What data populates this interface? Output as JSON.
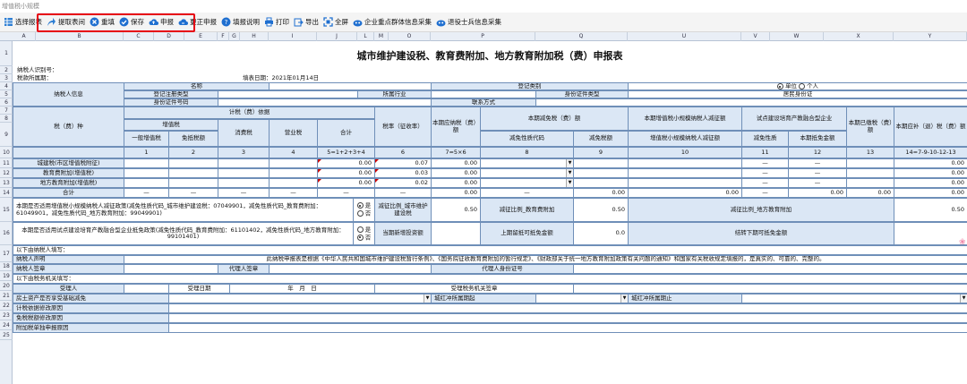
{
  "window": {
    "title": "增值税小规模"
  },
  "toolbar": {
    "items": [
      {
        "label": "选择报表",
        "icon": "table-icon"
      },
      {
        "label": "提取表间",
        "icon": "share-arrow-icon"
      },
      {
        "label": "重填",
        "icon": "clear-icon"
      },
      {
        "label": "保存",
        "icon": "check-circle-icon"
      },
      {
        "label": "申报",
        "icon": "cloud-upload-icon"
      },
      {
        "label": "更正申报",
        "icon": "cloud-sync-icon"
      },
      {
        "label": "填报说明",
        "icon": "help-icon"
      },
      {
        "label": "打印",
        "icon": "printer-icon"
      },
      {
        "label": "导出",
        "icon": "export-icon"
      },
      {
        "label": "全屏",
        "icon": "fullscreen-icon"
      },
      {
        "label": "企业重点群体信息采集",
        "icon": "people-icon"
      },
      {
        "label": "退役士兵信息采集",
        "icon": "people-icon"
      }
    ]
  },
  "columns": [
    "A",
    "B",
    "C",
    "D",
    "E",
    "F",
    "G",
    "H",
    "I",
    "J",
    "L",
    "M",
    "O",
    "P",
    "Q",
    "U",
    "V",
    "W",
    "X",
    "Y"
  ],
  "rows": [
    "1",
    "2",
    "3",
    "4",
    "5",
    "6",
    "7",
    "8",
    "9",
    "10",
    "11",
    "12",
    "13",
    "14",
    "15",
    "16",
    "17",
    "18",
    "19",
    "20",
    "21",
    "22",
    "23",
    "24",
    "25"
  ],
  "form": {
    "title": "城市维护建设税、教育费附加、地方教育附加税（费）申报表",
    "taxpayer_id_label": "纳税人识别号：",
    "period_label": "税款所属期：",
    "fill_date": "填表日期：2021年01月14日",
    "taxpayer_info": "纳税人信息",
    "name_label": "名称",
    "reg_type_label": "登记注册类型",
    "id_type_label": "身份证件类型",
    "id_no_label": "身份证件号码",
    "reg_category_label": "登记类别",
    "industry_label": "所属行业",
    "id_type2_label": "身份证件类型",
    "contact_label": "联系方式",
    "opt_unit": "单位",
    "opt_person": "个人",
    "id_type_value": "居民身份证",
    "tax_item": "税（费）种",
    "basis": "计税（费）依据",
    "vat": "增值税",
    "general_vat": "一般增值税",
    "exempt_vat": "免抵税额",
    "consumption_tax": "消费税",
    "business_tax": "营业税",
    "total": "合计",
    "rate": "税率（征收率）",
    "payable": "本期应纳税（费）额",
    "relief": "本期减免税（费）额",
    "relief_code": "减免性质代码",
    "relief_amt": "减免税额",
    "small_vat_relief": "本期增值税小规模纳税人减征额",
    "small_vat_relief_sub": "增值税小规模纳税人减征额",
    "pilot": "试点建设培育产教融合型企业",
    "pilot_code": "减免性质",
    "pilot_amt": "本期抵免金额",
    "prepaid": "本期已缴税（费）额",
    "refund": "本期应补（退）税（费）额",
    "idx": [
      "1",
      "2",
      "3",
      "4",
      "5=1+2+3+4",
      "6",
      "7=5×6",
      "8",
      "9",
      "10",
      "11",
      "12",
      "13",
      "14=7-9-10-12-13"
    ],
    "line_city": "城建税(市区增值税附征)",
    "line_edu": "教育费附加(增值税)",
    "line_local": "地方教育附加(增值税)",
    "line_total": "合计",
    "zero": "0.00",
    "rate_city": "0.07",
    "rate_edu": "0.03",
    "rate_local": "0.02",
    "dash": "—",
    "q15": "本期是否适用增值税小规模纳税人减征政策(减免性质代码_城市维护建设税：07049901，减免性质代码_教育费附加：61049901，减免性质代码_地方教育附加：99049901)",
    "yes": "是",
    "no": "否",
    "ratio_city_label": "减征比例_城市维护建设税",
    "ratio_city": "0.50",
    "ratio_edu_label": "减征比例_教育费附加",
    "ratio_edu": "0.50",
    "ratio_local_label": "减征比例_地方教育附加",
    "ratio_local": "0.50",
    "q16": "本期是否适用试点建设培育产教融合型企业抵免政策(减免性质代码_教育费附加：61101402，减免性质代码_地方教育附加：99101401)",
    "new_vat_label": "当期新增投资额",
    "prev_credit_label": "上期留抵可抵免金额",
    "prev_credit_val": "0.0",
    "carry_label": "结转下期可抵免金额",
    "sec_taxpayer": "以下由纳税人填写：",
    "declare_label": "纳税人声明",
    "declare_text": "此纳税申报表是根据《中华人民共和国城市维护建设税暂行条例》、《国务院征收教育费附加的暂行规定》、《财政部关于统一地方教育附加政策有关问题的通知》和国家有关税收规定填报的，是真实的、可靠的、完整的。",
    "sign_label": "纳税人签章",
    "agent_label": "代理人签章",
    "agent_id_label": "代理人身份证号",
    "sec_office": "以下由税务机关填写：",
    "receiver": "受理人",
    "receive_date": "受理日期",
    "ymd": "年　月　日",
    "office_seal": "受理税务机关签章",
    "r22": "房土资产是否享受基础减免",
    "r22b": "城红冲所属期起",
    "r22c": "城红冲所属期止",
    "r23": "计税依据修改原因",
    "r24": "免税税额修改原因",
    "r25": "附加税单独申报原因"
  }
}
